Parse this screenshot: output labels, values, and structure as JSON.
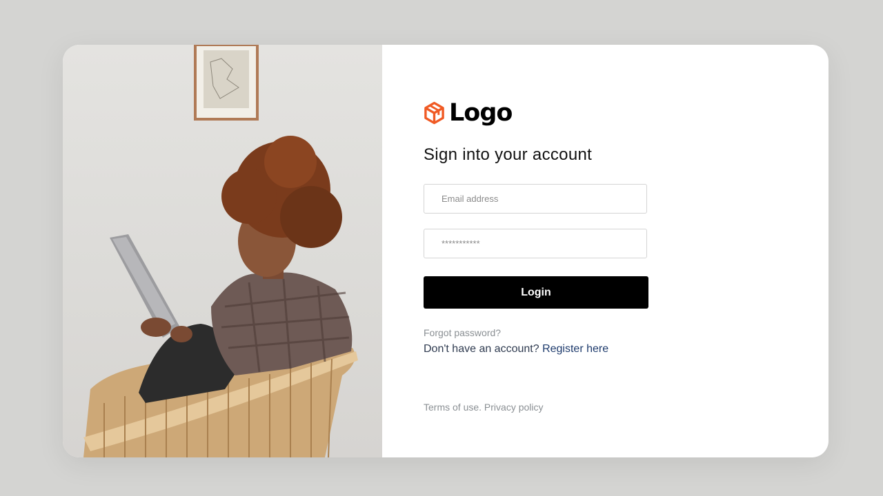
{
  "brand": {
    "name": "Logo",
    "icon": "cube-icon",
    "accent_color": "#f05a24"
  },
  "form": {
    "heading": "Sign into your account",
    "email_placeholder": "Email address",
    "password_placeholder": "***********",
    "login_label": "Login",
    "forgot_password": "Forgot password?",
    "register_prompt": "Don't have an account?",
    "register_link": "Register here"
  },
  "footer": {
    "terms": "Terms of use.",
    "privacy": "Privacy policy"
  },
  "colors": {
    "page_bg": "#d4d4d2",
    "card_bg": "#ffffff",
    "button_bg": "#000000",
    "link_color": "#1d3a6c",
    "muted_text": "#8a8f93"
  }
}
